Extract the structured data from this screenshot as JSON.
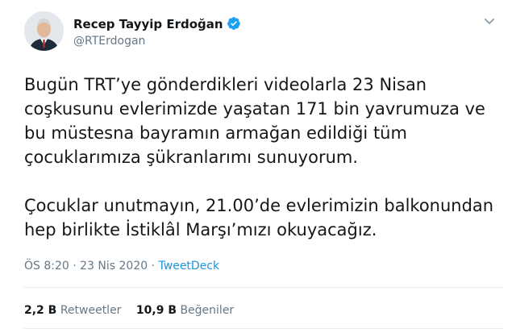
{
  "author": {
    "display_name": "Recep Tayyip Erdoğan",
    "handle": "@RTErdogan",
    "verified_icon": "verified-badge-icon",
    "avatar_icon": "profile-photo"
  },
  "tweet": {
    "paragraph1_lines": [
      "Bugün TRT’ye gönderdikleri videolarla 23 Nisan",
      "coşkusunu evlerimizde yaşatan 171 bin yavrumuza ve",
      "bu müstesna bayramın armağan edildiği tüm",
      "çocuklarımıza şükranlarımı sunuyorum."
    ],
    "paragraph2_lines": [
      "Çocuklar unutmayın, 21.00’de evlerimizin balkonundan",
      "hep birlikte İstiklâl Marşı’mızı okuyacağız."
    ]
  },
  "meta": {
    "time": "ÖS 8:20",
    "separator1": " · ",
    "date": "23 Nis 2020",
    "separator2": " · ",
    "source": "TweetDeck"
  },
  "stats": {
    "retweets_count": "2,2 B",
    "retweets_label": "Retweetler",
    "likes_count": "10,9 B",
    "likes_label": "Beğeniler"
  },
  "colors": {
    "link": "#1b95e0",
    "secondary_text": "#657786",
    "primary_text": "#14171a",
    "divider": "#e6ecf0",
    "verified": "#1da1f2"
  }
}
